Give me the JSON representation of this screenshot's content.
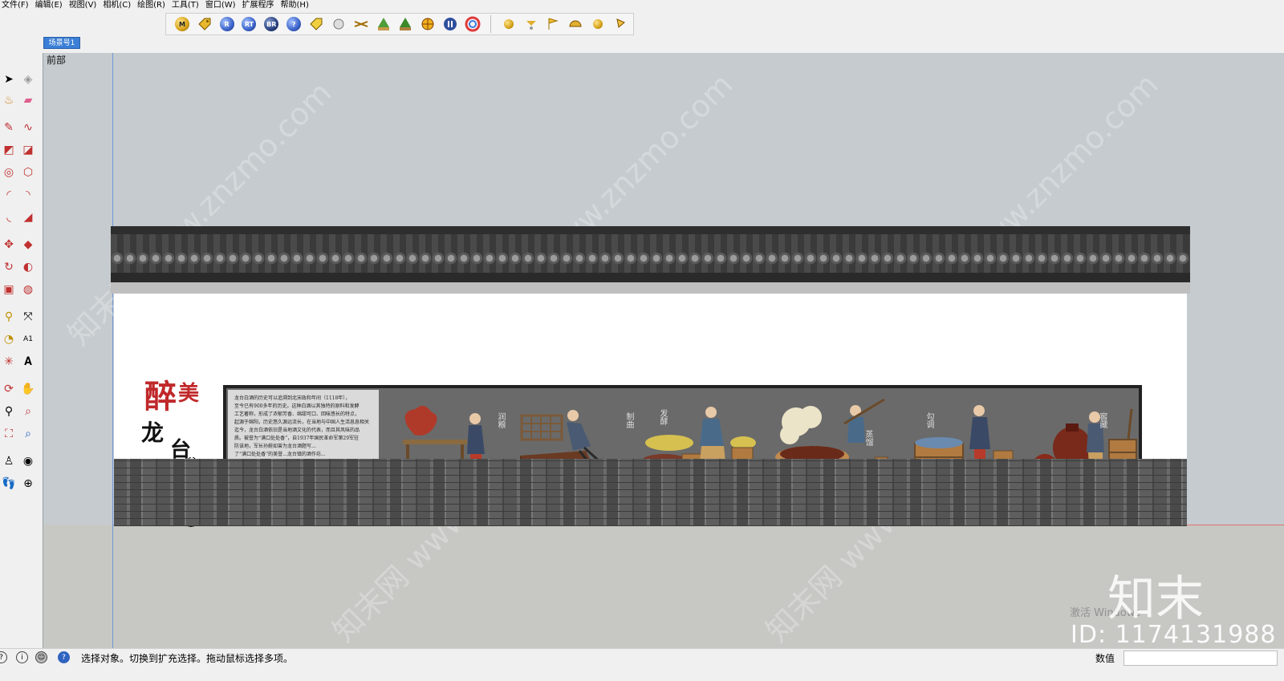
{
  "menu": [
    "文件(F)",
    "编辑(E)",
    "视图(V)",
    "相机(C)",
    "绘图(R)",
    "工具(T)",
    "窗口(W)",
    "扩展程序",
    "帮助(H)"
  ],
  "toolbar": {
    "ball_labels": [
      "M",
      "",
      "R",
      "RT",
      "BR",
      "?",
      "",
      "",
      "",
      "",
      "",
      "",
      "",
      "",
      ""
    ]
  },
  "scene_tab": "场景号1",
  "viewport": {
    "view_label": "前部"
  },
  "mural": {
    "calligraphy": [
      "醉",
      "美",
      "龙",
      "台"
    ],
    "text_lines": [
      "龙台白酒的历史可以追溯到北宋政和年间（1118年），",
      "至今已有900多年的历史。这种白酒以其独特的原料和发酵",
      "工艺著称，形成了浓郁芳香、绵甜可口、回味悠长的特点，",
      "起源于绵阳，历史悠久源远流长，在当地与中国人生活息息相关",
      "迄今，龙台白酒依旧是当地酒文化的代表，而且其风味的品",
      "质。被誉为“满口处处香”，自1937年国民革命军第29军驻",
      "防该地，军长孙蔚如曾为龙台酒题写...",
      "了“满口处处香”的美誉...龙台镇的酒作坊..."
    ],
    "process_labels": [
      "润粮",
      "制曲",
      "发酵",
      "蒸馏",
      "勾调",
      "窖藏"
    ]
  },
  "watermark": {
    "brand": "知末",
    "activation": "激活 Windows",
    "id": "ID: 1174131988",
    "diagonal": "知末网 www.znzmo.com"
  },
  "status": {
    "message": "选择对象。切换到扩充选择。拖动鼠标选择多项。",
    "measure_label": "数值"
  }
}
